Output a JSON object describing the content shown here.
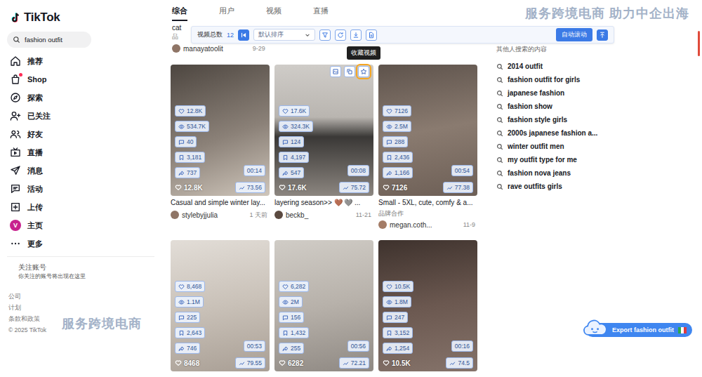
{
  "logo": {
    "text": "TikTok"
  },
  "watermarks": [
    "服务跨境电商 助力中企出海",
    "服务跨境电商"
  ],
  "sidebar": {
    "search": {
      "value": "fashion outfit"
    },
    "items": [
      {
        "label": "推荐",
        "selected": false,
        "badge": false
      },
      {
        "label": "Shop",
        "selected": false,
        "badge": true
      },
      {
        "label": "探索",
        "selected": false,
        "badge": false
      },
      {
        "label": "已关注",
        "selected": false,
        "badge": false
      },
      {
        "label": "好友",
        "selected": false,
        "badge": false
      },
      {
        "label": "直播",
        "selected": false,
        "badge": false
      },
      {
        "label": "消息",
        "selected": false,
        "badge": false
      },
      {
        "label": "活动",
        "selected": false,
        "badge": false
      },
      {
        "label": "上传",
        "selected": false,
        "badge": false
      },
      {
        "label": "主页",
        "selected": false,
        "badge": false,
        "avatar": "V"
      },
      {
        "label": "更多",
        "selected": false,
        "badge": false
      }
    ],
    "following": {
      "title": "关注账号",
      "hint": "你关注的账号将出现在这里"
    },
    "footer": [
      "公司",
      "计划",
      "条款和政策",
      "© 2025 TikTok"
    ]
  },
  "tabs": [
    {
      "label": "综合",
      "selected": true
    },
    {
      "label": "用户",
      "selected": false
    },
    {
      "label": "视频",
      "selected": false
    },
    {
      "label": "直播",
      "selected": false
    }
  ],
  "toolbar": {
    "total_label": "视频总数",
    "total": "12",
    "sort": "默认排序",
    "auto_scroll": "自动滚动"
  },
  "tooltip": {
    "text": "收藏视频"
  },
  "previous_result": {
    "title": "cat",
    "badge": "品",
    "author": "manayatoolit",
    "date": "9-29"
  },
  "cards": [
    {
      "stats": [
        "12.8K",
        "534.7K",
        "40",
        "3,181",
        "737"
      ],
      "duration": "00:14",
      "like_count": "12.8K",
      "score": "73.56",
      "title": "Casual and simple winter lay...",
      "author": "stylebyjjulia",
      "date": "1 天前",
      "hovered": false
    },
    {
      "stats": [
        "17.6K",
        "324.3K",
        "124",
        "4,197",
        "547"
      ],
      "duration": "00:08",
      "like_count": "17.6K",
      "score": "75.72",
      "title": "layering season>> 🤎 🩶 ...",
      "author": "beckb_",
      "date": "11-21",
      "hovered": true
    },
    {
      "stats": [
        "7126",
        "2.5M",
        "288",
        "2,436",
        "1,166"
      ],
      "duration": "00:54",
      "like_count": "7126",
      "score": "77.38",
      "title": "Small - 5XL, cute, comfy & a...",
      "badge": "品牌合作",
      "author": "megan.coth...",
      "date": "11-9",
      "hovered": false
    },
    {
      "stats": [
        "8,468",
        "1.1M",
        "225",
        "2,643",
        "746"
      ],
      "duration": "00:53",
      "like_count": "8468",
      "score": "79.55",
      "hovered": false
    },
    {
      "stats": [
        "6,282",
        "2M",
        "156",
        "1,432",
        "255"
      ],
      "duration": "00:56",
      "like_count": "6282",
      "score": "72.21",
      "hovered": false
    },
    {
      "stats": [
        "10.5K",
        "1.8M",
        "247",
        "3,152",
        "1,254"
      ],
      "duration": "00:16",
      "like_count": "10.5K",
      "score": "74.5",
      "hovered": false
    }
  ],
  "related": {
    "title": "其他人搜索的内容",
    "items": [
      "2014 outfit",
      "fashion outfit for girls",
      "japanese fashion",
      "fashion show",
      "fashion style girls",
      "2000s japanese fashion a...",
      "winter outfit men",
      "my outfit type for me",
      "fashion nova jeans",
      "rave outfits girls"
    ]
  },
  "export_button": {
    "label": "Export fashion outfit"
  }
}
